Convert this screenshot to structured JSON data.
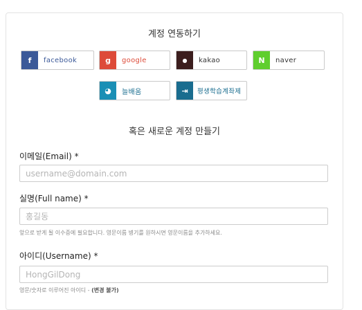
{
  "link_section": {
    "title": "계정 연동하기",
    "providers": [
      {
        "label": "facebook",
        "icon": "f",
        "color": "#3b5998",
        "text_color": "#3b5998"
      },
      {
        "label": "google",
        "icon": "g",
        "color": "#dd4b39",
        "text_color": "#dd4b39"
      },
      {
        "label": "kakao",
        "icon": "●",
        "color": "#3c1e1e",
        "text_color": "#333333"
      },
      {
        "label": "naver",
        "icon": "N",
        "color": "#5fce2e",
        "text_color": "#333333"
      },
      {
        "label": "늘배움",
        "icon": "◕",
        "color": "#1a8fb5",
        "text_color": "#1a6d8f"
      },
      {
        "label": "평생학습계좌제",
        "icon": "⇥",
        "color": "#1a6d8f",
        "text_color": "#1a6d8f"
      }
    ]
  },
  "new_section": {
    "title": "혹은 새로운 계정 만들기"
  },
  "form": {
    "email": {
      "label": "이메일(Email) *",
      "placeholder": "username@domain.com"
    },
    "fullname": {
      "label": "실명(Full name) *",
      "placeholder": "홍길동",
      "hint": "앞으로 받게 될 이수증에 필요합니다. 영문이름 병기를 원하시면 영문이름을 추가하세요."
    },
    "username": {
      "label": "아이디(Username) *",
      "placeholder": "HongGilDong",
      "hint_prefix": "영문/숫자로 이루어진 아이디 - ",
      "hint_bold": "(변경 불가)"
    }
  }
}
